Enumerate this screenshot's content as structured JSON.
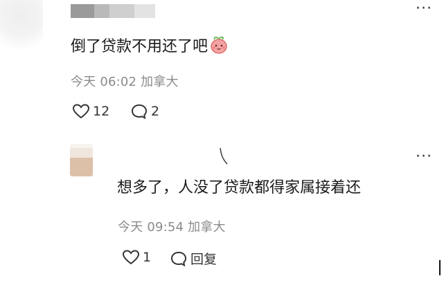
{
  "comment": {
    "text": "倒了贷款不用还了吧",
    "emoji_icon": "peach-face-emoji",
    "time": "今天 06:02",
    "location": "加拿大",
    "likes": "12",
    "replies": "2"
  },
  "reply": {
    "text": "想多了，人没了贷款都得家属接着还",
    "time": "今天 09:54",
    "location": "加拿大",
    "likes": "1",
    "reply_label": "回复"
  },
  "icons": {
    "more": "more-dots-icon",
    "like": "heart-icon",
    "comment": "comment-bubble-icon"
  },
  "colors": {
    "text": "#1a1a1a",
    "meta": "#8a8a8a",
    "emoji": "#f08a8a"
  }
}
